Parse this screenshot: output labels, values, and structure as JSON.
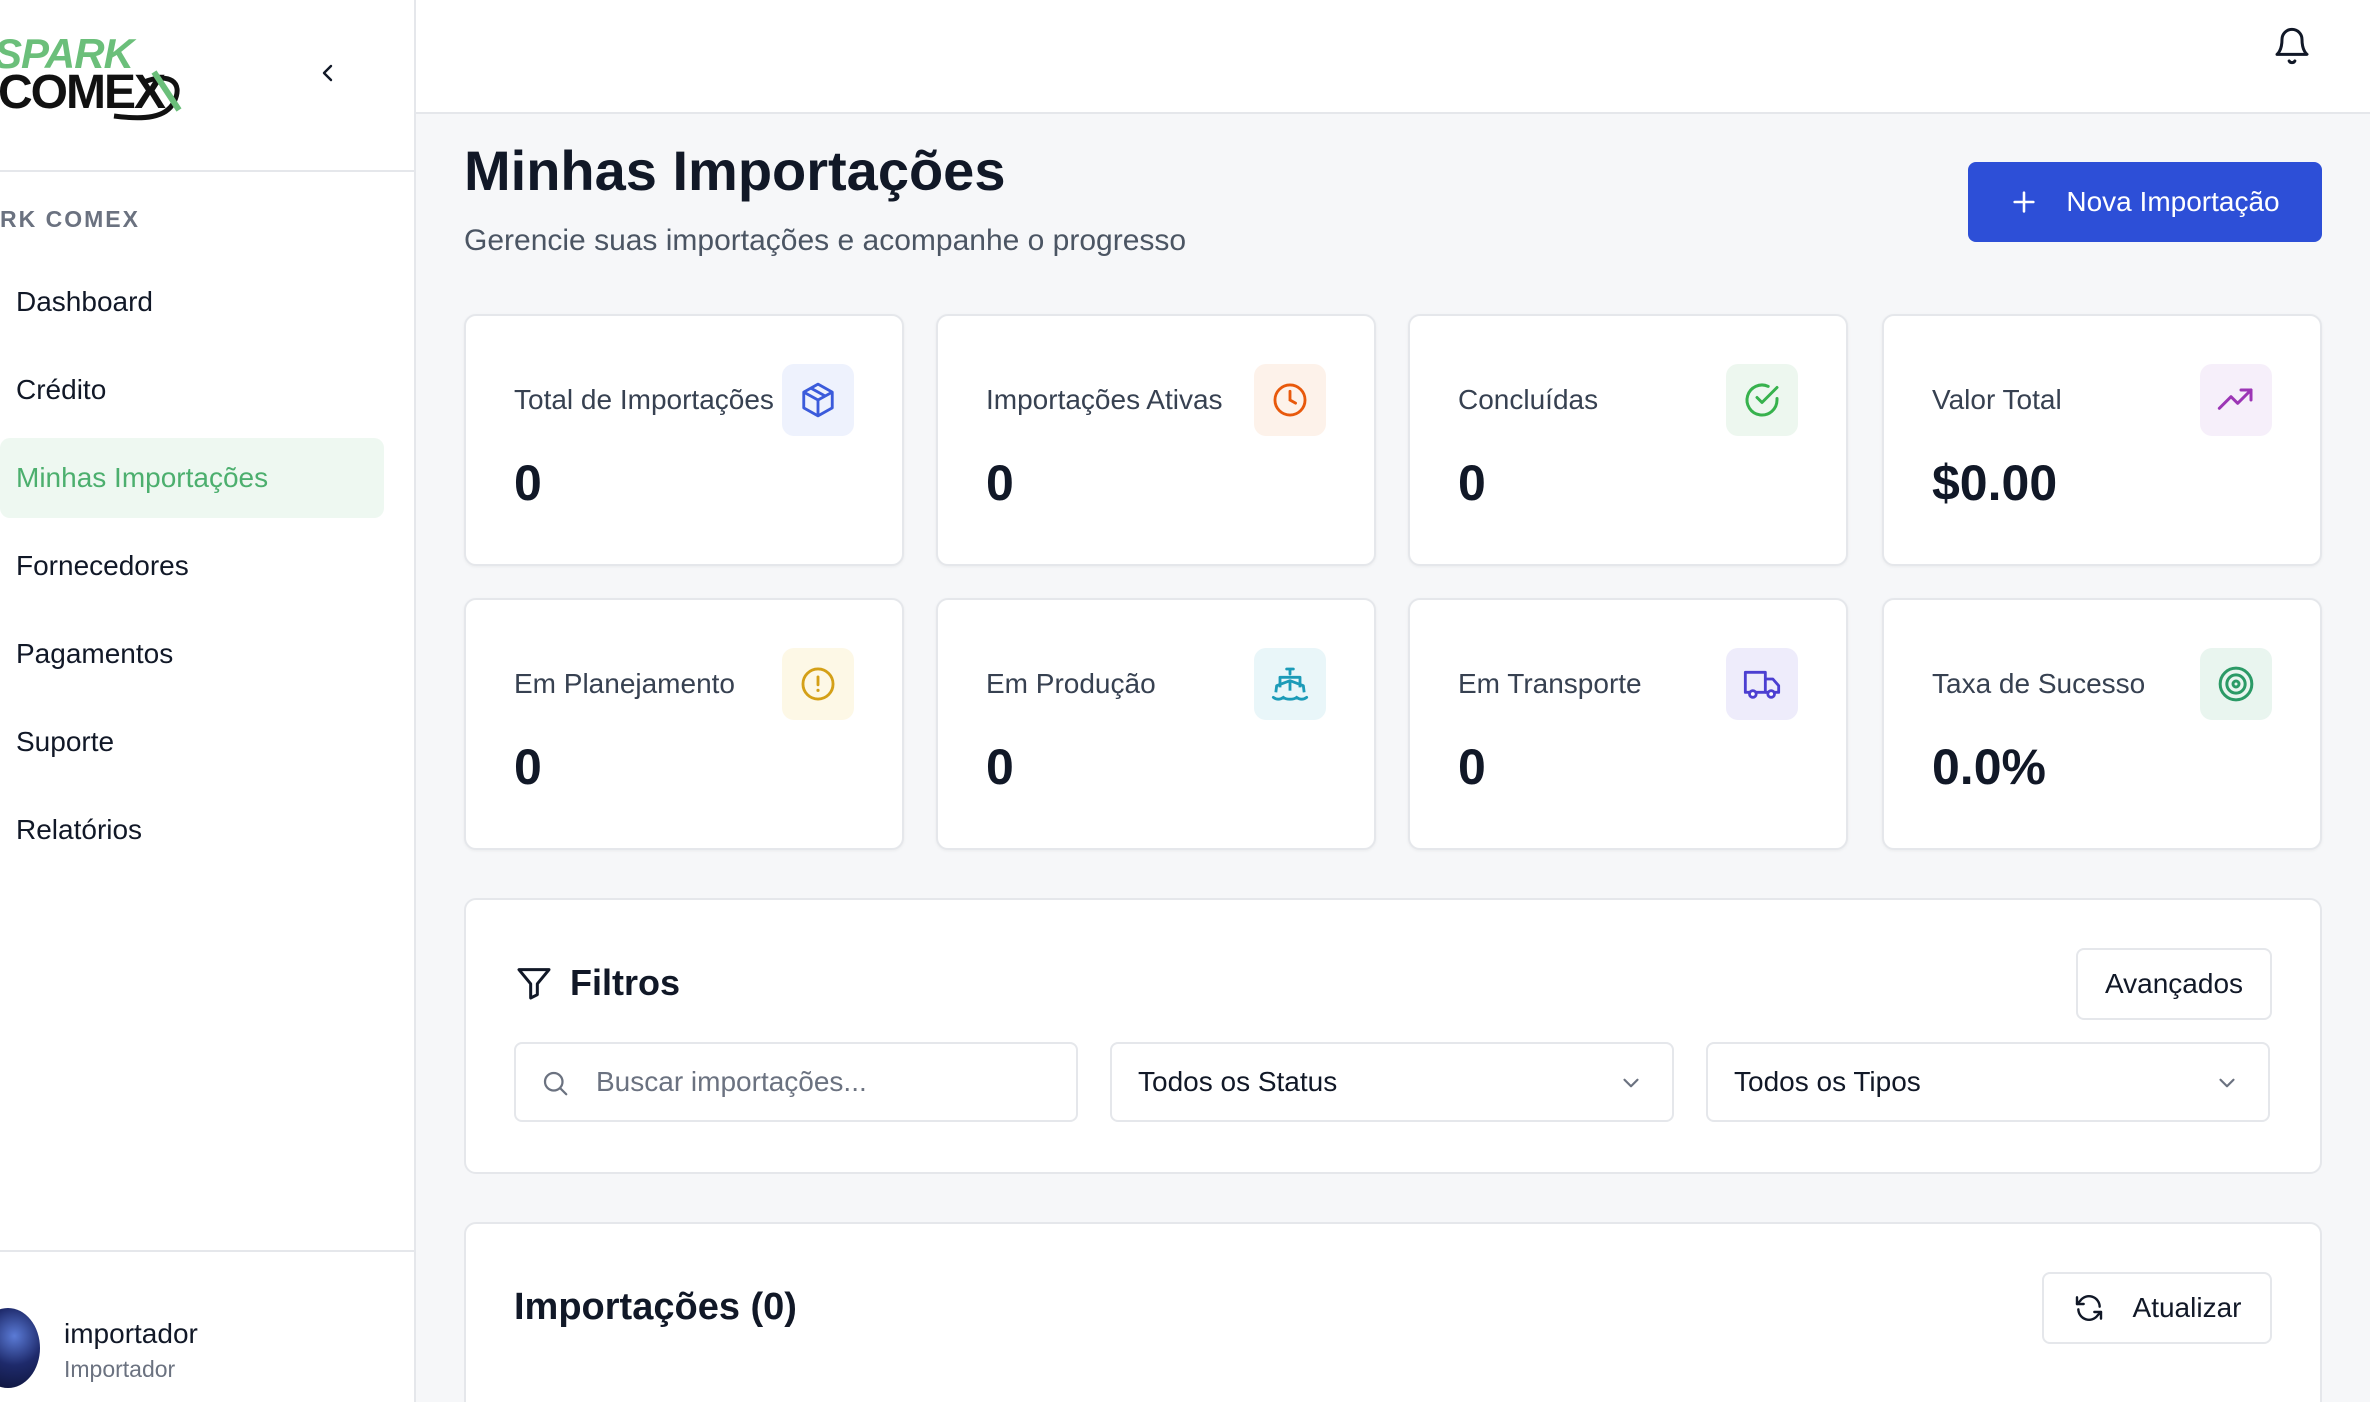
{
  "sidebar": {
    "logo_line1": "SPARK",
    "logo_line2": "COMEX",
    "section_label": "RK COMEX",
    "items": [
      {
        "label": "Dashboard"
      },
      {
        "label": "Crédito"
      },
      {
        "label": "Minhas Importações",
        "active": true
      },
      {
        "label": "Fornecedores"
      },
      {
        "label": "Pagamentos"
      },
      {
        "label": "Suporte"
      },
      {
        "label": "Relatórios"
      }
    ],
    "user": {
      "name": "importador",
      "role": "Importador"
    }
  },
  "topbar": {
    "notification_icon": "bell-icon"
  },
  "header": {
    "title": "Minhas Importações",
    "subtitle": "Gerencie suas importações e acompanhe o progresso",
    "new_button": "Nova Importação"
  },
  "stats": [
    {
      "label": "Total de Importações",
      "value": "0",
      "icon": "package-icon",
      "color": "#3b5bdb",
      "bg": "#eef2fd"
    },
    {
      "label": "Importações Ativas",
      "value": "0",
      "icon": "clock-icon",
      "color": "#e8590c",
      "bg": "#fdf2ea"
    },
    {
      "label": "Concluídas",
      "value": "0",
      "icon": "check-circle-icon",
      "color": "#37b24d",
      "bg": "#edf7ef"
    },
    {
      "label": "Valor Total",
      "value": "$0.00",
      "icon": "trending-up-icon",
      "color": "#9c36b5",
      "bg": "#f6effa"
    },
    {
      "label": "Em Planejamento",
      "value": "0",
      "icon": "alert-circle-icon",
      "color": "#d4a017",
      "bg": "#fdf8e6"
    },
    {
      "label": "Em Produção",
      "value": "0",
      "icon": "ship-icon",
      "color": "#1c9bb8",
      "bg": "#e9f6f9"
    },
    {
      "label": "Em Transporte",
      "value": "0",
      "icon": "truck-icon",
      "color": "#4c3fd1",
      "bg": "#eeecfb"
    },
    {
      "label": "Taxa de Sucesso",
      "value": "0.0%",
      "icon": "target-icon",
      "color": "#2b9a66",
      "bg": "#e9f5ef"
    }
  ],
  "filters": {
    "title": "Filtros",
    "advanced_button": "Avançados",
    "search_placeholder": "Buscar importações...",
    "status_select": "Todos os Status",
    "type_select": "Todos os Tipos"
  },
  "imports": {
    "title": "Importações (0)",
    "refresh_button": "Atualizar"
  }
}
